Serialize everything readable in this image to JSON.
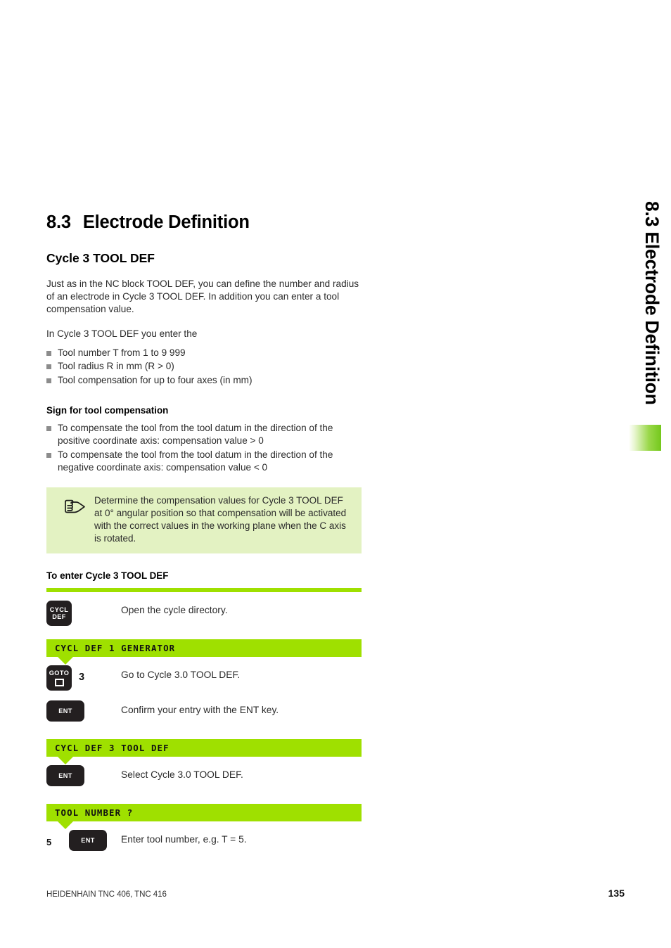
{
  "side_tab": {
    "label": "8.3 Electrode Definition",
    "accent_color": "#74c81c"
  },
  "section": {
    "number": "8.3",
    "title": "Electrode Definition",
    "subtitle": "Cycle 3 TOOL DEF"
  },
  "body": {
    "paragraph1": "Just as in the NC block TOOL DEF, you can define the number and radius of an electrode in Cycle 3 TOOL DEF. In addition you can enter a tool compensation value.",
    "paragraph2": "In Cycle 3 TOOL DEF you enter the",
    "bullets": [
      "Tool number T from 1 to 9 999",
      "Tool radius R in mm (R > 0)",
      "Tool compensation for up to four axes (in mm)"
    ]
  },
  "sign_section": {
    "heading": "Sign for tool compensation",
    "bullets": [
      "To compensate the tool from the tool datum in the direction of the positive coordinate axis: compensation value > 0",
      "To compensate the tool from the tool datum in the direction of the negative coordinate axis: compensation value < 0"
    ]
  },
  "note": {
    "icon": "pointing-hand-icon",
    "text": "Determine the compensation values for Cycle 3 TOOL DEF at 0° angular position so that compensation will be activated with the correct values in the working plane when the C axis is rotated.",
    "background_color": "#e3f2c2"
  },
  "procedure": {
    "heading": "To enter Cycle 3 TOOL DEF",
    "rule_color": "#9fe000",
    "steps": [
      {
        "key_label_line1": "CYCL",
        "key_label_line2": "DEF",
        "text": "Open the cycle directory."
      },
      {
        "key_label_line1": "GOTO",
        "arg": "3",
        "text": "Go to Cycle 3.0 TOOL DEF."
      },
      {
        "key_label_line1": "ENT",
        "text": "Confirm your entry with the ENT key."
      },
      {
        "key_label_line1": "ENT",
        "text": "Select Cycle 3.0 TOOL DEF."
      },
      {
        "key_label_line1": "ENT",
        "lead": "5",
        "text": "Enter tool number, e.g. T = 5."
      }
    ],
    "banners": [
      "CYCL DEF 1 GENERATOR",
      "CYCL DEF 3 TOOL DEF",
      "TOOL NUMBER ?"
    ],
    "banner_color": "#9fe000"
  },
  "footer": {
    "left": "HEIDENHAIN TNC 406, TNC 416",
    "page": "135"
  }
}
